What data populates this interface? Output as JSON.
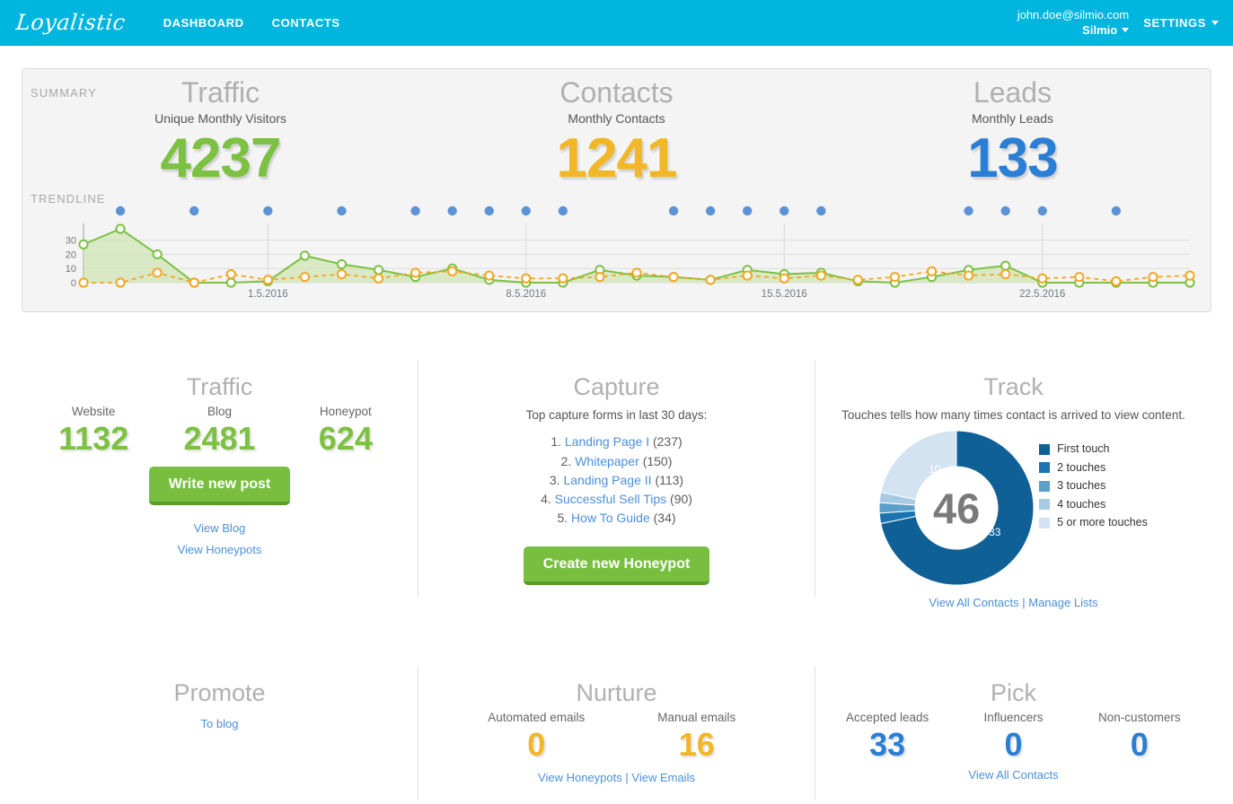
{
  "header": {
    "logo": "Loyalistic",
    "nav": [
      {
        "label": "DASHBOARD"
      },
      {
        "label": "CONTACTS"
      }
    ],
    "account_email": "john.doe@silmio.com",
    "account_org": "Silmio",
    "settings_label": "SETTINGS"
  },
  "summary": {
    "label": "SUMMARY",
    "trendline_label": "TRENDLINE",
    "kpis": [
      {
        "title": "Traffic",
        "subtitle": "Unique Monthly Visitors",
        "value": "4237",
        "color": "#7cc142"
      },
      {
        "title": "Contacts",
        "subtitle": "Monthly Contacts",
        "value": "1241",
        "color": "#f2b727"
      },
      {
        "title": "Leads",
        "subtitle": "Monthly Leads",
        "value": "133",
        "color": "#2a7fd4"
      }
    ]
  },
  "chart_data": {
    "type": "area",
    "title": "TRENDLINE",
    "xlabel": "",
    "ylabel": "",
    "ylim": [
      0,
      38
    ],
    "yticks": [
      0,
      10,
      20,
      30
    ],
    "grid": true,
    "legend": "none",
    "x_tick_labels": [
      "1.5.2016",
      "8.5.2016",
      "15.5.2016",
      "22.5.2016"
    ],
    "x_tick_indices": [
      5,
      12,
      19,
      26
    ],
    "x": [
      0,
      1,
      2,
      3,
      4,
      5,
      6,
      7,
      8,
      9,
      10,
      11,
      12,
      13,
      14,
      15,
      16,
      17,
      18,
      19,
      20,
      21,
      22,
      23,
      24,
      25,
      26,
      27,
      28,
      29,
      30
    ],
    "series": [
      {
        "name": "Visitors",
        "color": "#7cc142",
        "fill": "#cfe5b4",
        "style": "solid-area",
        "values": [
          27,
          38,
          20,
          0,
          0,
          1,
          19,
          13,
          9,
          4,
          10,
          2,
          0,
          0,
          9,
          5,
          4,
          2,
          9,
          6,
          7,
          1,
          0,
          4,
          9,
          12,
          0,
          0,
          0,
          0,
          0
        ]
      },
      {
        "name": "Contacts",
        "color": "#f5a623",
        "style": "dashed",
        "values": [
          0,
          0,
          7,
          0,
          6,
          2,
          4,
          6,
          3,
          7,
          8,
          5,
          3,
          3,
          4,
          7,
          4,
          2,
          5,
          3,
          5,
          2,
          4,
          8,
          5,
          6,
          3,
          4,
          1,
          4,
          5
        ]
      },
      {
        "name": "Leads",
        "color": "#5b93d6",
        "style": "dots",
        "values": [
          null,
          1,
          null,
          1,
          null,
          1,
          null,
          1,
          null,
          1,
          1,
          1,
          1,
          1,
          null,
          null,
          1,
          1,
          1,
          1,
          1,
          null,
          null,
          null,
          1,
          1,
          1,
          null,
          1,
          null,
          null
        ]
      }
    ]
  },
  "traffic": {
    "title": "Traffic",
    "stats": [
      {
        "label": "Website",
        "value": "1132"
      },
      {
        "label": "Blog",
        "value": "2481"
      },
      {
        "label": "Honeypot",
        "value": "624"
      }
    ],
    "button": "Write new post",
    "links": [
      "View Blog",
      "View Honeypots"
    ]
  },
  "capture": {
    "title": "Capture",
    "description": "Top capture forms in last 30 days:",
    "items": [
      {
        "rank": "1.",
        "name": "Landing Page I",
        "count": "(237)"
      },
      {
        "rank": "2.",
        "name": "Whitepaper",
        "count": "(150)"
      },
      {
        "rank": "3.",
        "name": "Landing Page II",
        "count": "(113)"
      },
      {
        "rank": "4.",
        "name": "Successful Sell Tips",
        "count": "(90)"
      },
      {
        "rank": "5.",
        "name": "How To Guide",
        "count": "(34)"
      }
    ],
    "button": "Create new Honeypot"
  },
  "track": {
    "title": "Track",
    "description": "Touches tells how many times contact is arrived to view content.",
    "center_value": "46",
    "slice_label_top": "10",
    "slice_label_right": "33",
    "donut": {
      "type": "pie",
      "labels": [
        "First touch",
        "2 touches",
        "3 touches",
        "4 touches",
        "5 or more touches"
      ],
      "values": [
        33,
        1,
        1,
        1,
        10
      ],
      "colors": [
        "#0f6096",
        "#1b74b0",
        "#5c9fc8",
        "#a8cbe3",
        "#d3e3f2"
      ]
    },
    "links": [
      "View All Contacts",
      "Manage Lists"
    ],
    "link_separator": "|"
  },
  "promote": {
    "title": "Promote",
    "link": "To blog"
  },
  "nurture": {
    "title": "Nurture",
    "stats": [
      {
        "label": "Automated emails",
        "value": "0"
      },
      {
        "label": "Manual emails",
        "value": "16"
      }
    ],
    "links": [
      "View Honeypots",
      "View Emails"
    ],
    "link_separator": "|"
  },
  "pick": {
    "title": "Pick",
    "stats": [
      {
        "label": "Accepted leads",
        "value": "33"
      },
      {
        "label": "Influencers",
        "value": "0"
      },
      {
        "label": "Non-customers",
        "value": "0"
      }
    ],
    "link": "View All Contacts"
  }
}
